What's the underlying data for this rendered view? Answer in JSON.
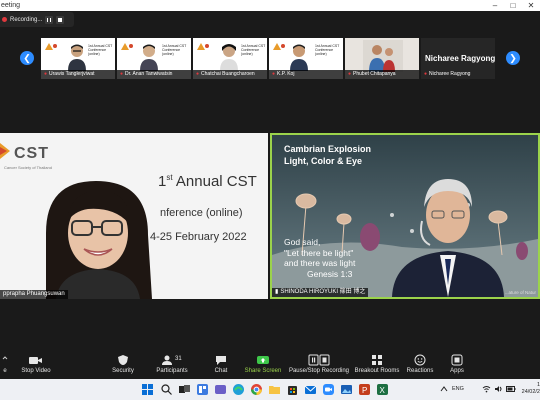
{
  "window": {
    "title": "eeting",
    "controls": [
      "–",
      "□",
      "✕"
    ]
  },
  "recording": {
    "label": "Recording...",
    "pause_icon": "pause-icon",
    "stop_icon": "stop-icon"
  },
  "gallery": {
    "prev_icon": "chevron-left-icon",
    "next_icon": "chevron-right-icon",
    "tiles": [
      {
        "name": "Urawis Tanglerjviwat",
        "slide_text": "1st Annual CST Conference (online)"
      },
      {
        "name": "Dr. Anan Tanwiwatsin",
        "slide_text": "1st Annual CST Conference (online)"
      },
      {
        "name": "Chatchai Buangcharoen",
        "slide_text": "1st Annual CST Conference (online)"
      },
      {
        "name": "K.P. Koj",
        "slide_text": "1st Annual CST Conference (online)"
      },
      {
        "name": "Phubet Chitapanya",
        "slide_text": ""
      },
      {
        "name": "Nicharee Ragyong",
        "display_name": "Nicharee Ragyong"
      }
    ]
  },
  "left_video": {
    "logo": "CST",
    "logo_sub": "Cancer Society of Thailand",
    "title_line1": "1",
    "title_sup": "st",
    "title_line1b": " Annual CST",
    "title_line2": "nference (online)",
    "date": "4-25 February 2022",
    "name": "pprapha Phuangsuwan"
  },
  "right_video": {
    "slide_title1": "Cambrian Explosion",
    "slide_title2": "Light, Color & Eye",
    "quote1": "God said,",
    "quote2": "\"Let there be light\"",
    "quote3": "and there was light",
    "quote_ref": "Genesis 1:3",
    "name": "SHINODA HIROYUKI 篠田 博之",
    "credit": "...ature of Natur"
  },
  "toolbar": {
    "items": [
      {
        "label": "e",
        "icon": "mute-caret-icon"
      },
      {
        "label": "Stop Video",
        "icon": "video-camera-icon"
      },
      {
        "label": "Security",
        "icon": "shield-icon"
      },
      {
        "label": "Participants",
        "icon": "participants-icon",
        "count": "31"
      },
      {
        "label": "Chat",
        "icon": "chat-icon"
      },
      {
        "label": "Share Screen",
        "icon": "share-screen-icon"
      },
      {
        "label": "Pause/Stop Recording",
        "icon": "pause-recording-icon"
      },
      {
        "label": "Breakout Rooms",
        "icon": "breakout-rooms-icon"
      },
      {
        "label": "Reactions",
        "icon": "reactions-icon"
      },
      {
        "label": "Apps",
        "icon": "apps-icon"
      }
    ]
  },
  "taskbar": {
    "lang": "ENG",
    "time": "1",
    "date": "24/02/2"
  },
  "colors": {
    "zoom_blue": "#2d8cff",
    "active_speaker_border": "#9bd34b",
    "recording_red": "#e0393e"
  }
}
